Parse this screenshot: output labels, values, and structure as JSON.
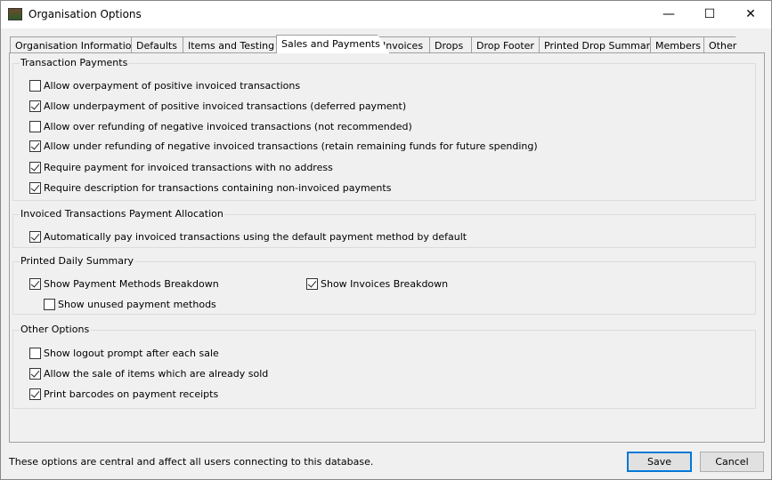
{
  "window": {
    "title": "Organisation Options",
    "minimize": "—",
    "maximize": "☐",
    "close": "✕"
  },
  "tabs": [
    "Organisation Information",
    "Defaults",
    "Items and Testing",
    "Sales and Payments",
    "Invoices",
    "Drops",
    "Drop Footer",
    "Printed Drop Summary",
    "Members",
    "Other"
  ],
  "selected_tab": "Sales and Payments",
  "groups": {
    "transaction_payments": {
      "title": "Transaction Payments",
      "items": [
        {
          "label": "Allow overpayment of positive invoiced transactions",
          "checked": false
        },
        {
          "label": "Allow underpayment of positive invoiced transactions (deferred payment)",
          "checked": true
        },
        {
          "label": "Allow over refunding of negative invoiced transactions (not recommended)",
          "checked": false
        },
        {
          "label": "Allow under refunding of negative invoiced transactions (retain remaining funds for future spending)",
          "checked": true
        },
        {
          "label": "Require payment for invoiced transactions with no address",
          "checked": true
        },
        {
          "label": "Require description for transactions containing non-invoiced payments",
          "checked": true
        }
      ]
    },
    "allocation": {
      "title": "Invoiced Transactions Payment Allocation",
      "items": [
        {
          "label": "Automatically pay invoiced transactions using the default payment method by default",
          "checked": true
        }
      ]
    },
    "daily_summary": {
      "title": "Printed Daily Summary",
      "items": [
        {
          "label": "Show Payment Methods Breakdown",
          "checked": true
        },
        {
          "label": "Show unused payment methods",
          "checked": false
        },
        {
          "label": "Show Invoices Breakdown",
          "checked": true
        }
      ]
    },
    "other": {
      "title": "Other Options",
      "items": [
        {
          "label": "Show logout prompt after each sale",
          "checked": false
        },
        {
          "label": "Allow the sale of items which are already sold",
          "checked": true
        },
        {
          "label": "Print barcodes on payment receipts",
          "checked": true
        }
      ]
    }
  },
  "footer": {
    "note": "These options are central and affect all users connecting to this database.",
    "save": "Save",
    "cancel": "Cancel"
  },
  "colors": {
    "accent": "#0078d7"
  }
}
